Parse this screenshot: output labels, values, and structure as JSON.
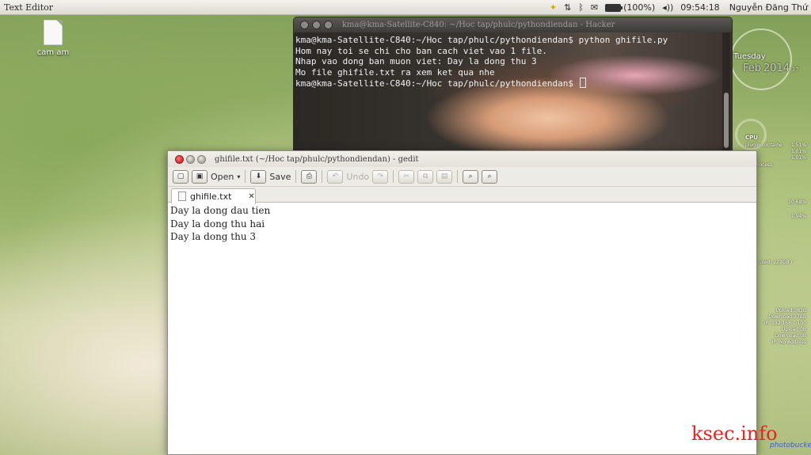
{
  "panel": {
    "app_title": "Text Editor",
    "battery": "(100%)",
    "time": "09:54:18",
    "user": "Nguyễn Đăng Thứ",
    "icons": [
      "update-icon",
      "network-arrows-icon",
      "bluetooth-icon",
      "mail-icon",
      "battery-icon",
      "volume-icon",
      "apple-icon"
    ]
  },
  "desktop": {
    "icon_label": "cam am"
  },
  "widgets": {
    "day": "Tuesday",
    "month": "Feb",
    "year": "2014",
    "date": "17",
    "cpu_title": "CPU",
    "cpu_rows": [
      {
        "name": "plugin-containe",
        "value": "1.51%"
      },
      {
        "name": "",
        "value": "1.01%"
      },
      {
        "name": "",
        "value": "1.01%"
      }
    ],
    "process_label": "rocess",
    "pct_1": "10.68%",
    "pct_2": "1.94%",
    "disk_label": "used: 223GB /",
    "net": [
      "Upload:383B",
      "Download:27BB",
      "IP: 192.168.1.100",
      "Upload:0B",
      "Download:0B",
      "IP: No Address"
    ]
  },
  "terminal": {
    "title": "kma@kma-Satellite-C840: ~/Hoc tap/phulc/pythondiendan - Hacker",
    "lines": [
      "kma@kma-Satellite-C840:~/Hoc tap/phulc/pythondiendan$ python ghifile.py",
      "Hom nay toi se chi cho ban cach viet vao 1 file.",
      "Nhap vao dong ban muon viet: Day la dong thu 3",
      "Mo file ghifile.txt ra xem ket qua nhe",
      "kma@kma-Satellite-C840:~/Hoc tap/phulc/pythondiendan$ "
    ]
  },
  "gedit": {
    "title": "ghifile.txt (~/Hoc tap/phulc/pythondiendan) - gedit",
    "toolbar": {
      "open_label": "Open",
      "save_label": "Save",
      "undo_label": "Undo"
    },
    "tab_label": "ghifile.txt",
    "tab_close": "✕",
    "lines": [
      "Day la dong dau tien",
      "Day la dong thu hai",
      "Day la dong thu 3"
    ]
  },
  "watermark": {
    "text": "ksec.info",
    "small": "photobucket"
  }
}
